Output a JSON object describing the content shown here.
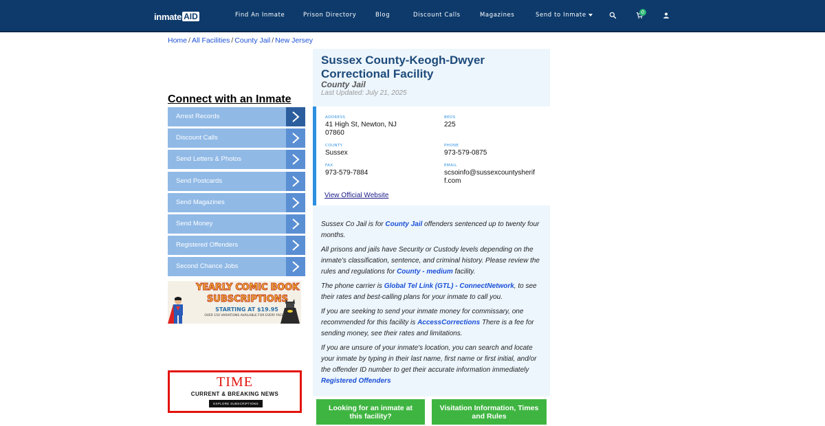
{
  "nav": {
    "logo_text": "inmate",
    "logo_aid": "AID",
    "links": [
      "Find An Inmate",
      "Prison Directory",
      "Blog",
      "Discount Calls",
      "Magazines",
      "Send to Inmate"
    ],
    "cart_count": "0",
    "icons": [
      "search-icon",
      "cart-icon",
      "user-icon"
    ],
    "color": "#0d3a6b"
  },
  "breadcrumb": [
    "Home",
    "All Facilities",
    "County Jail",
    "New Jersey"
  ],
  "sidebar": {
    "title": "Connect with an Inmate",
    "items": [
      "Arrest Records",
      "Discount Calls",
      "Send Letters & Photos",
      "Send Postcards",
      "Send Magazines",
      "Send Money",
      "Registered Offenders",
      "Second Chance Jobs"
    ]
  },
  "ads": {
    "comic": {
      "line1": "YEARLY COMIC BOOK",
      "line2": "SUBSCRIPTIONS",
      "line3": "STARTING AT $19.95",
      "line4": "OVER 150 VARIATIONS AVAILABLE FOR EVERY FACILITY"
    },
    "time": {
      "logo": "TIME",
      "subtitle": "CURRENT & BREAKING NEWS",
      "button": "EXPLORE SUBSCRIPTIONS"
    }
  },
  "facility": {
    "name": "Sussex County-Keogh-Dwyer Correctional Facility",
    "type": "County Jail",
    "updated": "Last Updated: July 21, 2025",
    "address_label": "ADDRESS",
    "address": "41 High St, Newton, NJ 07860",
    "beds_label": "BEDS",
    "beds": "225",
    "county_label": "COUNTY",
    "county": "Sussex",
    "phone_label": "PHONE",
    "phone": "973-579-0875",
    "fax_label": "FAX",
    "fax": "973-579-7884",
    "email_label": "EMAIL",
    "email": "scsoinfo@sussexcountysherif f.com",
    "website_label": "View Official Website"
  },
  "description": {
    "p1_a": "Sussex Co Jail is for ",
    "p1_link": "County Jail",
    "p1_b": " offenders sentenced up to twenty four months.",
    "p2_a": "All prisons and jails have Security or Custody levels depending on the inmate's classification, sentence, and criminal history. Please review the rules and regulations for ",
    "p2_link": "County - medium",
    "p2_b": " facility.",
    "p3_a": "The phone carrier is ",
    "p3_link": "Global Tel Link (GTL) - ConnectNetwork",
    "p3_b": ", to see their rates and best-calling plans for your inmate to call you.",
    "p4_a": "If you are seeking to send your inmate money for commissary, one recommended for this facility is ",
    "p4_link": "AccessCorrections",
    "p4_b": " There is a fee for sending money, see their rates and limitations.",
    "p5_a": "If you are unsure of your inmate's location, you can search and locate your inmate by typing in their last name, first name or first initial, and/or the offender ID number to get their accurate information immediately ",
    "p5_link": "Registered Offenders"
  },
  "buttons": {
    "find_inmate": "Looking for an inmate at this facility?",
    "visitation": "Visitation Information, Times and Rules",
    "color": "#3fb541"
  }
}
